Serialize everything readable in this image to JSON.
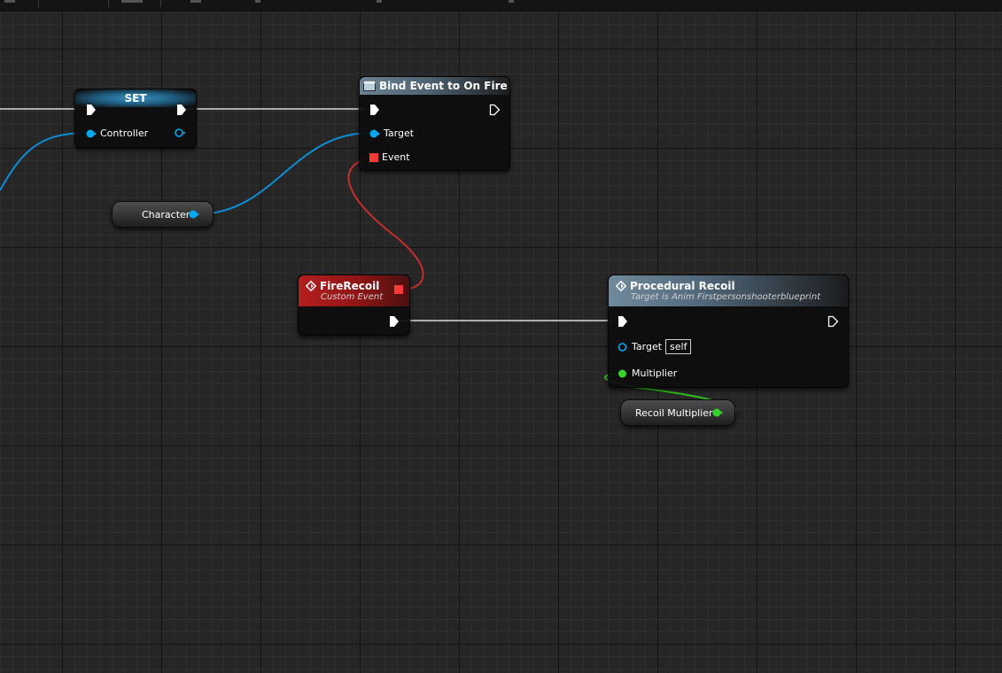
{
  "nodes": {
    "set": {
      "title": "SET",
      "pin_controller": "Controller"
    },
    "bind_event": {
      "title": "Bind Event to On Fire",
      "pin_target": "Target",
      "pin_event": "Event"
    },
    "character": {
      "label": "Character"
    },
    "fire_recoil": {
      "title": "FireRecoil",
      "subtitle": "Custom Event"
    },
    "procedural_recoil": {
      "title": "Procedural Recoil",
      "subtitle": "Target is Anim Firstpersonshooterblueprint",
      "pin_target": "Target",
      "target_default": "self",
      "pin_multiplier": "Multiplier"
    },
    "recoil_multiplier": {
      "label": "Recoil Multiplier"
    }
  },
  "colors": {
    "exec": "#ffffff",
    "object_pin": "#00a8f2",
    "delegate_pin": "#ff3838",
    "float_pin": "#39d12c",
    "set_header": "#2a6f96",
    "function_header": "#5a7588",
    "event_header": "#a31717",
    "graph_bg": "#262626"
  },
  "icons": [
    "exec-pin-icon",
    "function-icon",
    "event-icon",
    "object-pin-icon",
    "delegate-pin-icon",
    "float-pin-icon"
  ]
}
